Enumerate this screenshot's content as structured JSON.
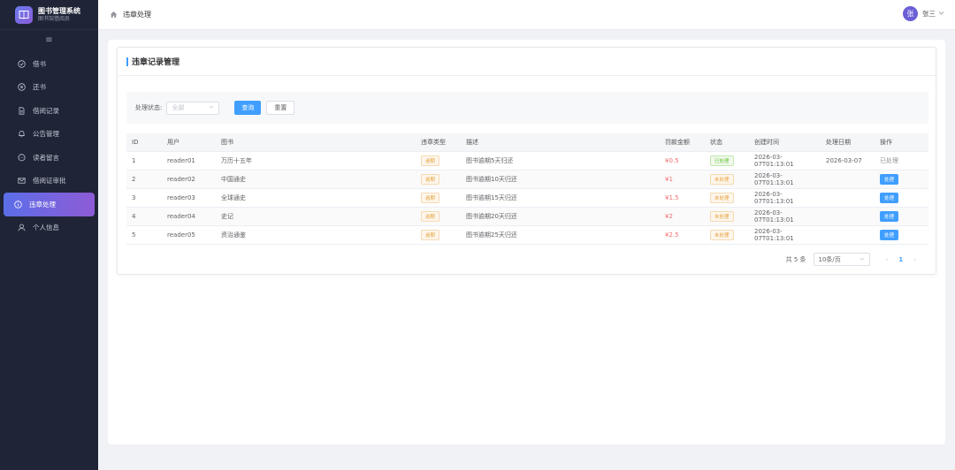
{
  "app": {
    "title": "图书管理系统",
    "subtitle": "图书馆借阅员"
  },
  "sidebar": {
    "items": [
      {
        "label": "借书",
        "icon": "check-circle-icon"
      },
      {
        "label": "还书",
        "icon": "x-circle-icon"
      },
      {
        "label": "借阅记录",
        "icon": "document-icon"
      },
      {
        "label": "公告管理",
        "icon": "bell-icon"
      },
      {
        "label": "读者留言",
        "icon": "chat-icon"
      },
      {
        "label": "借阅证审批",
        "icon": "mail-icon"
      },
      {
        "label": "违章处理",
        "icon": "info-icon",
        "active": true
      },
      {
        "label": "个人信息",
        "icon": "user-icon"
      }
    ]
  },
  "header": {
    "breadcrumb": "违章处理",
    "avatar_text": "张",
    "user_name": "张三"
  },
  "panel": {
    "title": "违章记录管理"
  },
  "filter": {
    "label": "处理状态:",
    "select_value": "全部",
    "query_label": "查询",
    "reset_label": "重置"
  },
  "table": {
    "columns": [
      "ID",
      "用户",
      "图书",
      "违章类型",
      "描述",
      "罚款金额",
      "状态",
      "创建时间",
      "处理日期",
      "操作"
    ],
    "rows": [
      {
        "id": "1",
        "user": "reader01",
        "book": "万历十五年",
        "type": "逾期",
        "desc": "图书逾期5天归还",
        "fine": "¥0.5",
        "status": "已处理",
        "created": "2026-03-07T01:13:01",
        "processed": "2026-03-07",
        "op": "已处理"
      },
      {
        "id": "2",
        "user": "reader02",
        "book": "中国通史",
        "type": "逾期",
        "desc": "图书逾期10天归还",
        "fine": "¥1",
        "status": "未处理",
        "created": "2026-03-07T01:13:01",
        "processed": "",
        "op": "处理"
      },
      {
        "id": "3",
        "user": "reader03",
        "book": "全球通史",
        "type": "逾期",
        "desc": "图书逾期15天归还",
        "fine": "¥1.5",
        "status": "未处理",
        "created": "2026-03-07T01:13:01",
        "processed": "",
        "op": "处理"
      },
      {
        "id": "4",
        "user": "reader04",
        "book": "史记",
        "type": "逾期",
        "desc": "图书逾期20天归还",
        "fine": "¥2",
        "status": "未处理",
        "created": "2026-03-07T01:13:01",
        "processed": "",
        "op": "处理"
      },
      {
        "id": "5",
        "user": "reader05",
        "book": "资治通鉴",
        "type": "逾期",
        "desc": "图书逾期25天归还",
        "fine": "¥2.5",
        "status": "未处理",
        "created": "2026-03-07T01:13:01",
        "processed": "",
        "op": "处理"
      }
    ]
  },
  "pagination": {
    "total": "共 5 条",
    "page_size": "10条/页",
    "current_page": "1"
  },
  "colors": {
    "primary": "#409eff",
    "sidebar_bg": "#1f2537",
    "active_gradient_start": "#5b6ee8",
    "active_gradient_end": "#8e5bd6",
    "danger": "#f56c6c",
    "success": "#67c23a",
    "warning": "#e6a23c"
  }
}
